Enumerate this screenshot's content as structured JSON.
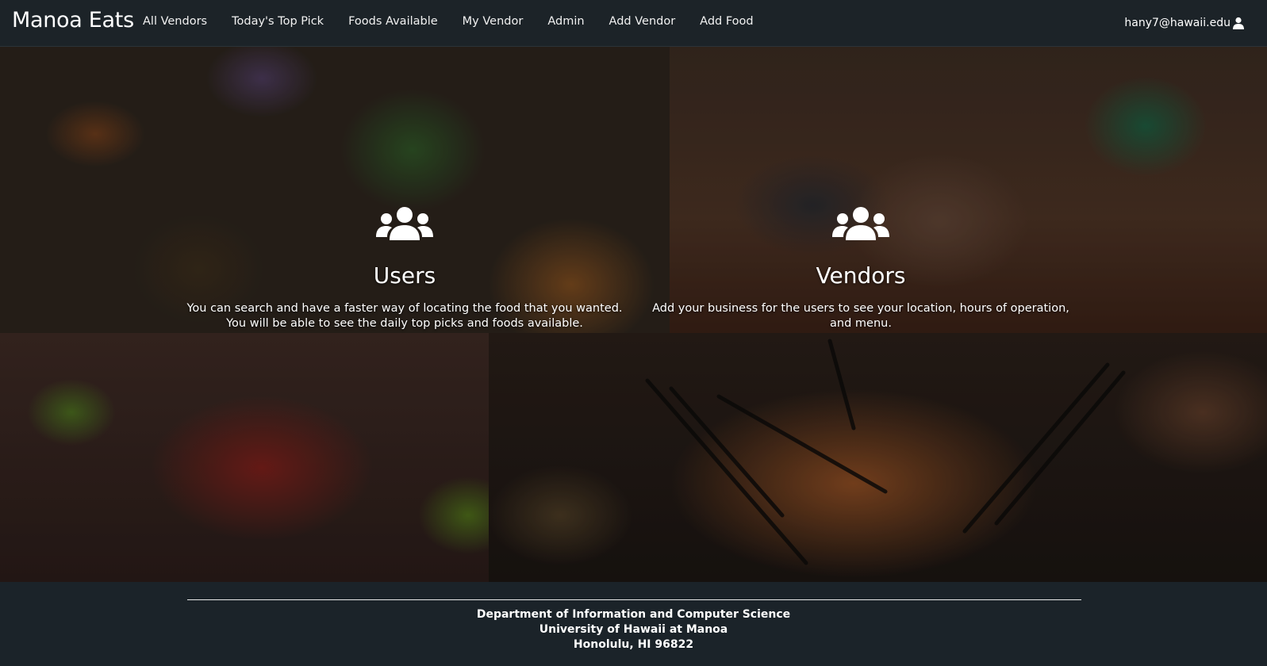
{
  "navbar": {
    "brand": "Manoa Eats",
    "links": [
      "All Vendors",
      "Today's Top Pick",
      "Foods Available",
      "My Vendor",
      "Admin",
      "Add Vendor",
      "Add Food"
    ],
    "user_email": "hany7@hawaii.edu",
    "user_icon": "user-icon"
  },
  "features": {
    "users": {
      "icon": "users-icon",
      "title": "Users",
      "text": "You can search and have a faster way of locating the food that you wanted. You will be able to see the daily top picks and foods available."
    },
    "vendors": {
      "icon": "users-icon",
      "title": "Vendors",
      "text": "Add your business for the users to see your location, hours of operation, and menu."
    }
  },
  "footer": {
    "lines": [
      "Department of Information and Computer Science",
      "University of Hawaii at Manoa",
      "Honolulu, HI 96822"
    ]
  },
  "colors": {
    "navbar_bg": "#1c2328",
    "footer_bg": "#1b2329",
    "text": "#ffffff"
  }
}
